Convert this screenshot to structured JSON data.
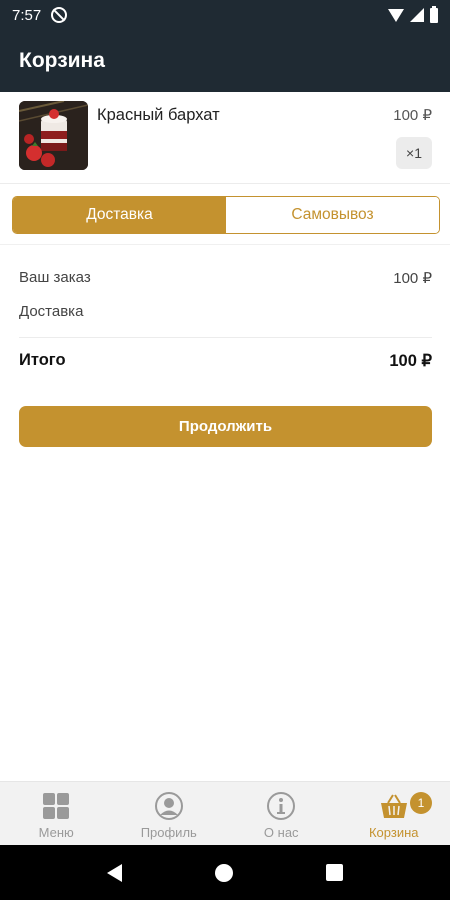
{
  "status_bar": {
    "time": "7:57"
  },
  "app_bar": {
    "title": "Корзина"
  },
  "cart_item": {
    "name": "Красный бархат",
    "price": "100 ₽",
    "quantity": "×1"
  },
  "delivery_toggle": {
    "delivery": "Доставка",
    "pickup": "Самовывоз",
    "selected": "delivery"
  },
  "summary": {
    "order_label": "Ваш заказ",
    "order_value": "100 ₽",
    "delivery_label": "Доставка",
    "delivery_value": "",
    "total_label": "Итого",
    "total_value": "100 ₽"
  },
  "continue_label": "Продолжить",
  "bottom_nav": {
    "menu": "Меню",
    "profile": "Профиль",
    "about": "О нас",
    "cart": "Корзина",
    "cart_count": "1",
    "active": "cart"
  },
  "colors": {
    "accent": "#c4922f",
    "header": "#1f2a33"
  }
}
